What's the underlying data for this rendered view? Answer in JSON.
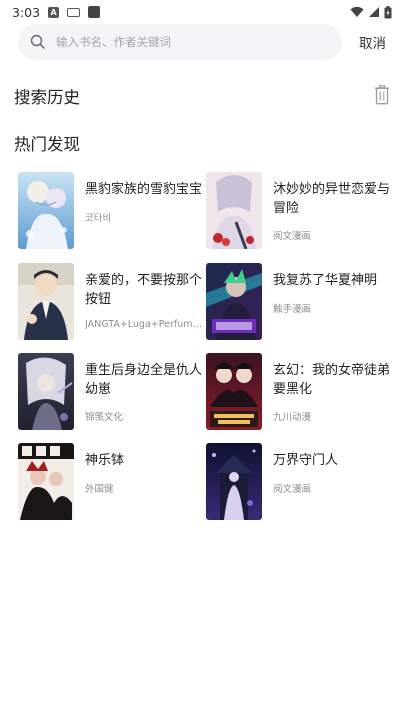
{
  "status_bar": {
    "time": "3:03",
    "notif_letter": "A"
  },
  "search": {
    "placeholder": "输入书名、作者关键词",
    "value": "",
    "cancel_label": "取消"
  },
  "history": {
    "title": "搜索历史"
  },
  "hot": {
    "title": "热门发现",
    "items": [
      {
        "title": "黑豹家族的雪豹宝宝",
        "author": "코타비"
      },
      {
        "title": "沐妙妙的异世恋爱与冒险",
        "author": "阅文漫画"
      },
      {
        "title": "亲爱的，不要按那个按钮",
        "author": "JANGTA+Luga+Perfumm Mix"
      },
      {
        "title": "我复苏了华夏神明",
        "author": "触手漫画"
      },
      {
        "title": "重生后身边全是仇人幼崽",
        "author": "锦笺文化"
      },
      {
        "title": "玄幻：我的女帝徒弟要黑化",
        "author": "九川动漫"
      },
      {
        "title": "神乐钵",
        "author": "外国健"
      },
      {
        "title": "万界守门人",
        "author": "阅文漫画"
      }
    ]
  },
  "colors": {
    "search_bg": "#f4f4f6",
    "placeholder": "#a5a5aa",
    "secondary_text": "#8e8e93"
  }
}
